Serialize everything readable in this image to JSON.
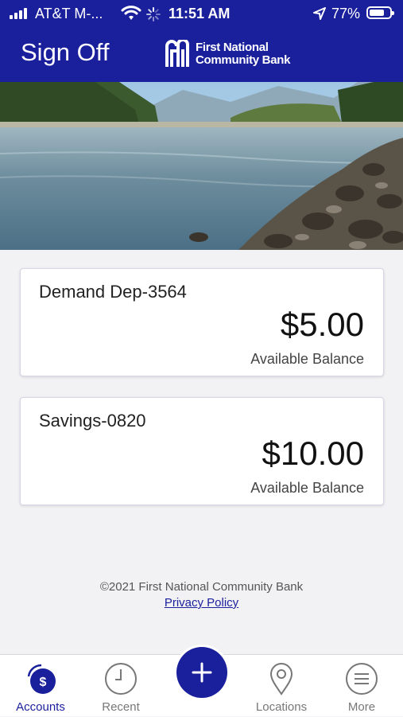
{
  "status_bar": {
    "carrier": "AT&T M-...",
    "time": "11:51 AM",
    "battery": "77%",
    "battery_level": 0.77
  },
  "header": {
    "sign_off": "Sign Off",
    "logo_line1": "First National",
    "logo_line2": "Community Bank"
  },
  "accounts": [
    {
      "name": "Demand Dep-3564",
      "balance": "$5.00",
      "balance_label": "Available Balance"
    },
    {
      "name": "Savings-0820",
      "balance": "$10.00",
      "balance_label": "Available Balance"
    }
  ],
  "footer": {
    "copyright": "©2021 First National Community Bank",
    "privacy_link": "Privacy Policy"
  },
  "tabs": [
    {
      "label": "Accounts",
      "icon": "dollar-circle-icon",
      "active": true
    },
    {
      "label": "Recent",
      "icon": "clock-icon"
    },
    {
      "label": "",
      "icon": "plus-icon"
    },
    {
      "label": "Locations",
      "icon": "map-pin-icon"
    },
    {
      "label": "More",
      "icon": "hamburger-menu-icon"
    }
  ],
  "colors": {
    "brand": "#1a1f9c",
    "background": "#f2f2f4",
    "card": "#ffffff"
  }
}
